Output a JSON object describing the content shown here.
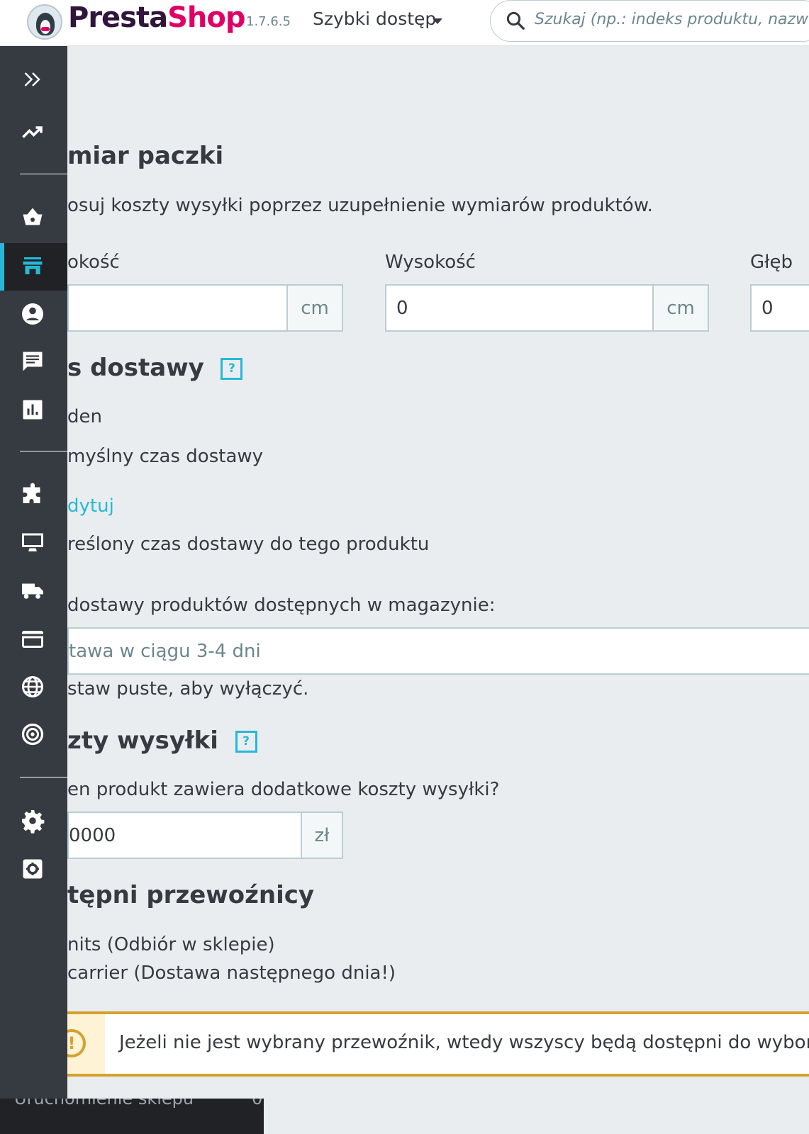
{
  "header": {
    "brand_a": "Presta",
    "brand_b": "Shop",
    "version": "1.7.6.5",
    "quick_access": "Szybki dostęp",
    "search_placeholder": "Szukaj (np.: indeks produktu, nazwa"
  },
  "sidebar": {
    "icons": [
      "expand-icon",
      "dashboard-trend-icon",
      "orders-basket-icon",
      "catalog-store-icon",
      "customers-icon",
      "messages-icon",
      "stats-icon",
      "modules-puzzle-icon",
      "design-monitor-icon",
      "shipping-truck-icon",
      "payment-card-icon",
      "international-globe-icon",
      "marketing-target-icon",
      "settings-gear-icon",
      "advanced-settings-icon"
    ],
    "bottom_label": "Uruchomienie sklepu",
    "bottom_count": "0"
  },
  "package": {
    "title": "miar paczki",
    "description": "osuj koszty wysyłki poprzez uzupełnienie wymiarów produktów.",
    "width_label": "okość",
    "width_unit": "cm",
    "height_label": "Wysokość",
    "height_value": "0",
    "height_unit": "cm",
    "depth_label": "Głęb",
    "depth_value": "0"
  },
  "delivery": {
    "title": "s dostawy",
    "help": "?",
    "option_none": "den",
    "option_default": "myślny czas dostawy",
    "edit_link": "dytuj",
    "option_specific": "reślony czas dostawy do tego produktu",
    "in_stock_label": "dostawy produktów dostępnych w magazynie:",
    "in_stock_placeholder": "tawa w ciągu 3-4 dni",
    "hint": "staw puste, aby wyłączyć."
  },
  "shipping_fees": {
    "title": "zty wysyłki",
    "help": "?",
    "question": "en produkt zawiera dodatkowe koszty wysyłki?",
    "value": "0000",
    "currency": "zł"
  },
  "carriers": {
    "title": "tępni przewoźnicy",
    "items": [
      "nits (Odbiór w sklepie)",
      "carrier (Dostawa następnego dnia!)"
    ]
  },
  "alert": {
    "icon": "!",
    "text": "Jeżeli nie jest wybrany przewoźnik, wtedy wszyscy będą dostępni do wyboru"
  }
}
